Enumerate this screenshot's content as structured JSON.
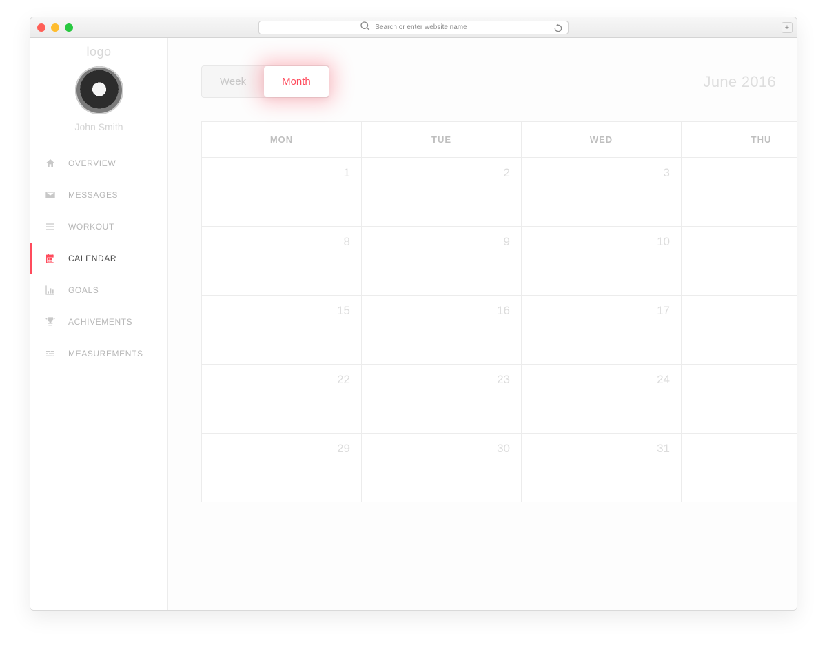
{
  "browser": {
    "search_placeholder": "Search or enter website name"
  },
  "sidebar": {
    "logo": "logo",
    "username": "John Smith",
    "items": [
      {
        "label": "OVERVIEW",
        "icon": "home-icon"
      },
      {
        "label": "MESSAGES",
        "icon": "mail-icon"
      },
      {
        "label": "WORKOUT",
        "icon": "list-icon"
      },
      {
        "label": "CALENDAR",
        "icon": "calendar-icon"
      },
      {
        "label": "GOALS",
        "icon": "chart-icon"
      },
      {
        "label": "ACHIVEMENTS",
        "icon": "trophy-icon"
      },
      {
        "label": "MEASUREMENTS",
        "icon": "sliders-icon"
      }
    ]
  },
  "tabs": {
    "week": "Week",
    "month": "Month"
  },
  "header": {
    "period": "June 2016"
  },
  "calendar": {
    "days": [
      "MON",
      "TUE",
      "WED",
      "THU"
    ],
    "cells": [
      "1",
      "2",
      "3",
      "",
      "8",
      "9",
      "10",
      "",
      "15",
      "16",
      "17",
      "",
      "22",
      "23",
      "24",
      "",
      "29",
      "30",
      "31",
      ""
    ]
  }
}
